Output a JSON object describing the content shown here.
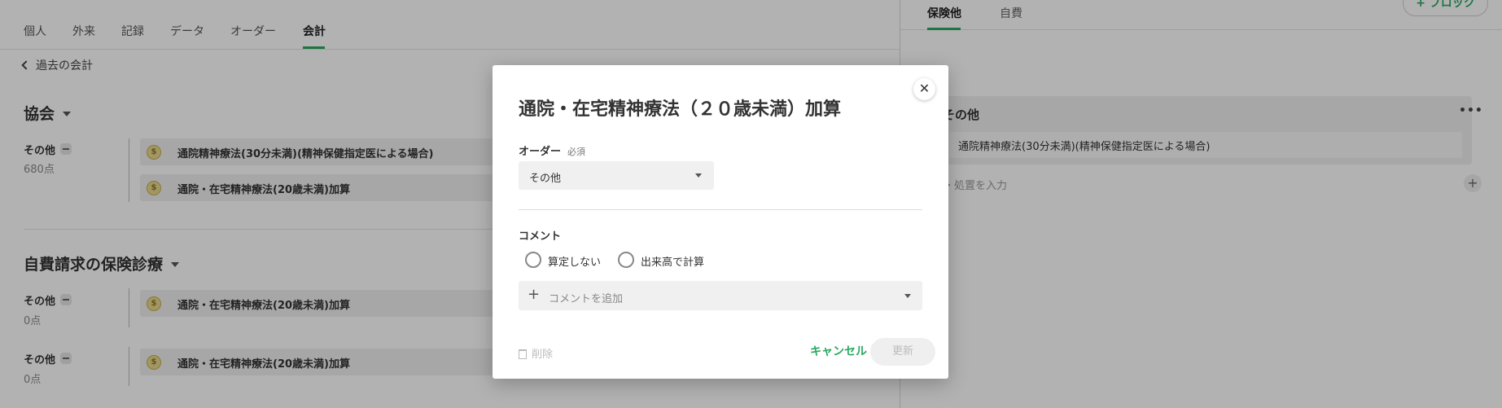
{
  "left": {
    "tabs": [
      "個人",
      "外来",
      "記録",
      "データ",
      "オーダー",
      "会計"
    ],
    "active_tab": "会計",
    "back_link": "過去の会計",
    "sections": [
      {
        "title": "協会",
        "groups": [
          {
            "label": "その他",
            "points": "680点",
            "items": [
              "通院精神療法(30分未満)(精神保健指定医による場合)",
              "通院・在宅精神療法(20歳未満)加算"
            ]
          }
        ]
      },
      {
        "title": "自費請求の保険診療",
        "groups": [
          {
            "label": "その他",
            "points": "0点",
            "items": [
              "通院・在宅精神療法(20歳未満)加算"
            ]
          },
          {
            "label": "その他",
            "points": "0点",
            "items": [
              "通院・在宅精神療法(20歳未満)加算"
            ]
          }
        ]
      }
    ]
  },
  "right": {
    "tabs": [
      "保険他",
      "自費"
    ],
    "active_tab": "保険他",
    "block_button": "+ ブロック",
    "card": {
      "title": "その他",
      "more": "•••",
      "item": "通院精神療法(30分未満)(精神保健指定医による場合)",
      "input_hint": "・処置を入力",
      "add": "+"
    }
  },
  "modal": {
    "title": "通院・在宅精神療法（２０歳未満）加算",
    "close": "✕",
    "order_label": "オーダー",
    "required": "必須",
    "order_value": "その他",
    "comment_label": "コメント",
    "radio_options": [
      "算定しない",
      "出来高で計算"
    ],
    "comment_placeholder": "コメントを追加",
    "comment_plus": "+",
    "delete_label": "削除",
    "cancel_label": "キャンセル",
    "update_label": "更新"
  },
  "colors": {
    "accent": "#2aa860",
    "overlay": "rgba(0,0,0,0.30)"
  }
}
